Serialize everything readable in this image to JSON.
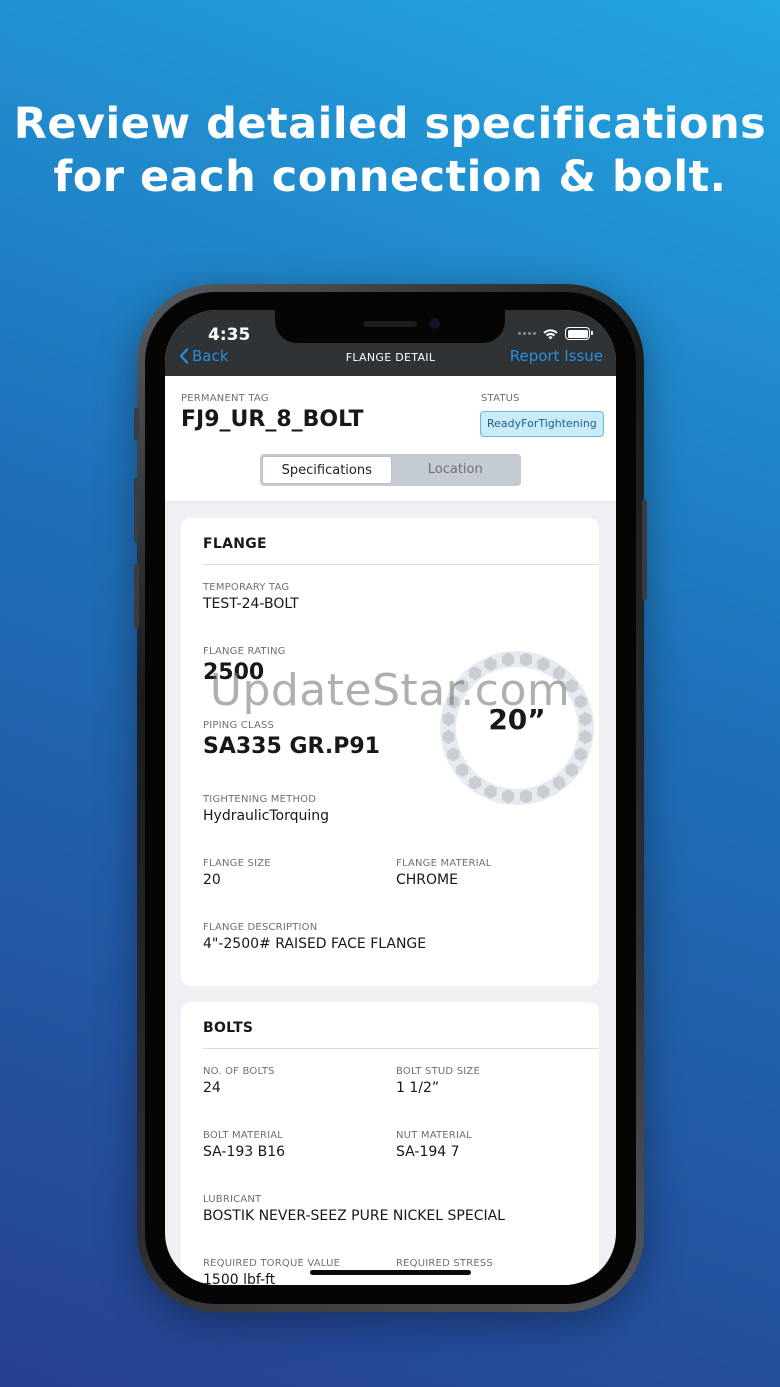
{
  "headline": {
    "line1": "Review detailed specifications",
    "line2": "for each connection & bolt."
  },
  "status_bar": {
    "time": "4:35"
  },
  "navbar": {
    "back_label": "Back",
    "title": "FLANGE DETAIL",
    "report_label": "Report Issue"
  },
  "header": {
    "permanent_tag_label": "PERMANENT TAG",
    "permanent_tag_value": "FJ9_UR_8_BOLT",
    "status_label": "STATUS",
    "status_value": "ReadyForTightening",
    "tabs": [
      {
        "label": "Specifications",
        "active": true
      },
      {
        "label": "Location",
        "active": false
      }
    ]
  },
  "flange": {
    "title": "FLANGE",
    "temporary_tag_label": "TEMPORARY TAG",
    "temporary_tag_value": "TEST-24-BOLT",
    "rating_label": "FLANGE RATING",
    "rating_value": "2500",
    "piping_class_label": "PIPING CLASS",
    "piping_class_value": "SA335 GR.P91",
    "tightening_method_label": "TIGHTENING METHOD",
    "tightening_method_value": "HydraulicTorquing",
    "size_label": "FLANGE SIZE",
    "size_value": "20",
    "material_label": "FLANGE MATERIAL",
    "material_value": "CHROME",
    "description_label": "FLANGE DESCRIPTION",
    "description_value": "4\"-2500# RAISED FACE FLANGE",
    "diagram_label": "20”",
    "diagram_bolt_count": 24
  },
  "bolts": {
    "title": "BOLTS",
    "count_label": "NO. OF BOLTS",
    "count_value": "24",
    "stud_size_label": "BOLT STUD SIZE",
    "stud_size_value": "1 1/2”",
    "material_label": "BOLT MATERIAL",
    "material_value": "SA-193 B16",
    "nut_material_label": "NUT MATERIAL",
    "nut_material_value": "SA-194 7",
    "lubricant_label": "LUBRICANT",
    "lubricant_value": "BOSTIK NEVER-SEEZ PURE NICKEL SPECIAL",
    "torque_label": "REQUIRED TORQUE VALUE",
    "torque_value": "1500 lbf-ft",
    "stress_label": "REQUIRED STRESS"
  },
  "watermark": "UpdateStar.com",
  "colors": {
    "accent": "#2b8fde",
    "navbar": "#2f3336",
    "badge_bg": "#c9ecf8",
    "bolt_hex": "#c9cdd3"
  }
}
